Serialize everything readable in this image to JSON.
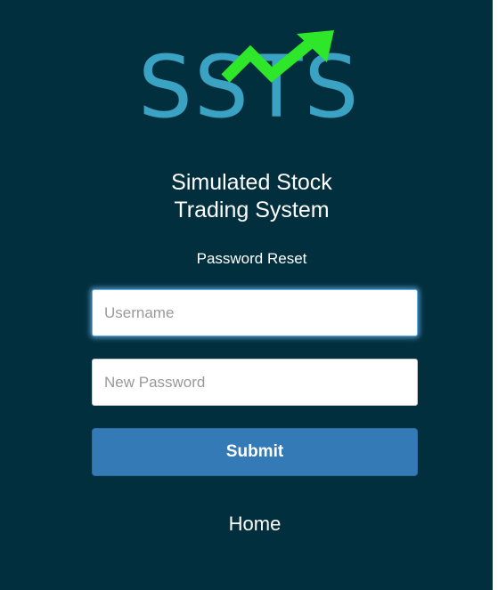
{
  "brand": {
    "logo_text": "SSTS",
    "logo_text_color": "#3aa2c2",
    "arrow_color": "#2ee62a",
    "title_line1": "Simulated Stock",
    "title_line2": "Trading System"
  },
  "page": {
    "subtitle": "Password Reset",
    "background_color": "#022f3d"
  },
  "form": {
    "username": {
      "value": "",
      "placeholder": "Username",
      "focused": true
    },
    "password": {
      "value": "",
      "placeholder": "New Password"
    },
    "submit_label": "Submit",
    "submit_color": "#337ab7"
  },
  "nav": {
    "home_label": "Home"
  }
}
